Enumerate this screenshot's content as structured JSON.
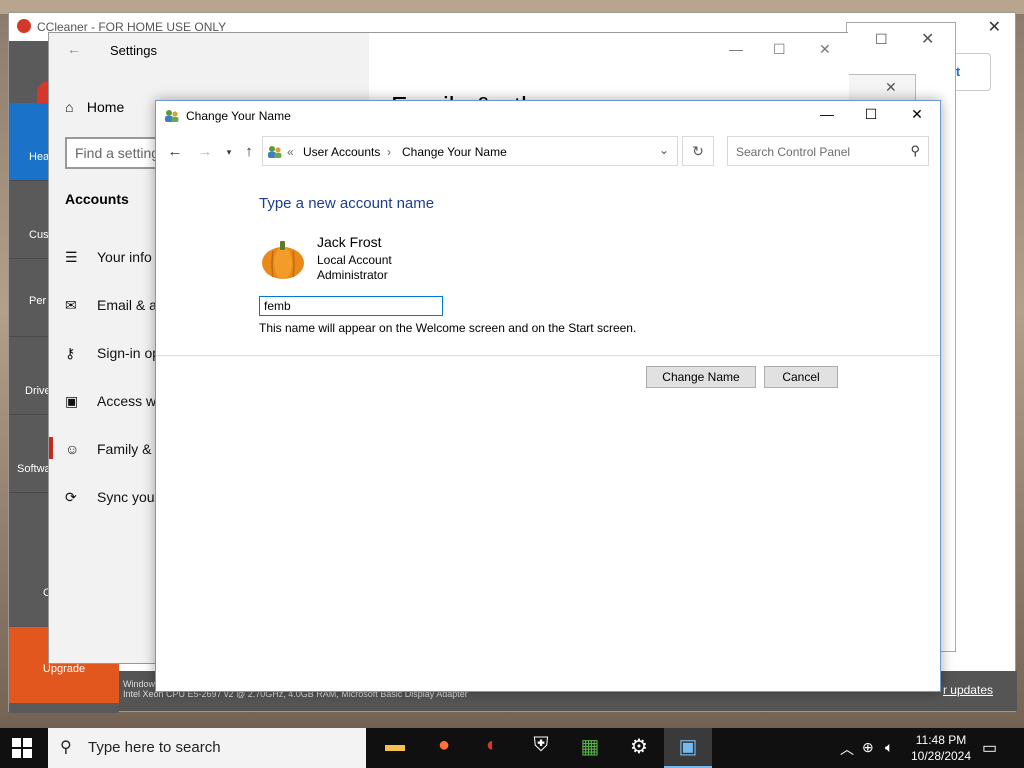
{
  "ccleaner": {
    "title": "CCleaner - FOR HOME USE ONLY",
    "sidebar": [
      "Hea",
      "Cus",
      "Per\nO",
      "Drive",
      "Softwa",
      "C"
    ],
    "upgrade": "Upgrade",
    "account_btn": "unt",
    "bottom_info_1": "Windows",
    "bottom_info_2": "Intel Xeon CPU E5-2697 v2 @ 2.70GHz, 4.0GB RAM, Microsoft Basic Display Adapter",
    "updates_link": "r updates"
  },
  "settings": {
    "title": "Settings",
    "home": "Home",
    "search_placeholder": "Find a setting",
    "section": "Accounts",
    "page_heading": "Family & oth",
    "items": [
      "Your info",
      "Email & ac",
      "Sign-in op",
      "Access wo",
      "Family & o",
      "Sync your"
    ]
  },
  "dialog": {
    "title": "Change Your Name",
    "breadcrumb": [
      "User Accounts",
      "Change Your Name"
    ],
    "search_placeholder": "Search Control Panel",
    "heading": "Type a new account name",
    "user": {
      "name": "Jack Frost",
      "type": "Local Account",
      "role": "Administrator"
    },
    "new_name_value": "femb",
    "hint": "This name will appear on the Welcome screen and on the Start screen.",
    "change_button": "Change Name",
    "cancel_button": "Cancel"
  },
  "taskbar": {
    "search_placeholder": "Type here to search",
    "time": "11:48 PM",
    "date": "10/28/2024"
  },
  "colors": {
    "accent": "#0078d7",
    "heading_blue": "#1e3d8f",
    "ccleaner_blue": "#1a73c9",
    "ccleaner_orange": "#e2571e"
  }
}
